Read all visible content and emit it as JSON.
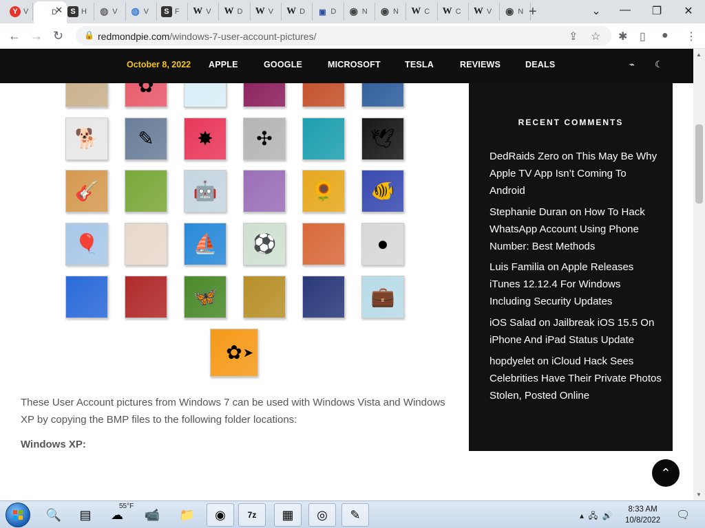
{
  "browser": {
    "tabs": [
      {
        "letter": "V",
        "icon": "yandex-icon",
        "color": "#e5322d",
        "glyph": "Y"
      },
      {
        "letter": "D",
        "icon": "page-icon",
        "color": "#ffffff",
        "glyph": ""
      },
      {
        "letter": "H",
        "icon": "s-icon",
        "color": "#333333",
        "glyph": "S"
      },
      {
        "letter": "V",
        "icon": "globe-icon",
        "color": "#666666",
        "glyph": "◍"
      },
      {
        "letter": "V",
        "icon": "globe-color-icon",
        "color": "#3b7dd8",
        "glyph": "◍"
      },
      {
        "letter": "F",
        "icon": "s-icon",
        "color": "#333333",
        "glyph": "S"
      },
      {
        "letter": "V",
        "icon": "wikipedia-icon",
        "color": "#222222",
        "glyph": "W"
      },
      {
        "letter": "D",
        "icon": "wikipedia-icon",
        "color": "#222222",
        "glyph": "W"
      },
      {
        "letter": "V",
        "icon": "wikipedia-icon",
        "color": "#222222",
        "glyph": "W"
      },
      {
        "letter": "D",
        "icon": "wikipedia-icon",
        "color": "#222222",
        "glyph": "W"
      },
      {
        "letter": "D",
        "icon": "monitor-icon",
        "color": "#2a4fa0",
        "glyph": "▣"
      },
      {
        "letter": "N",
        "icon": "github-icon",
        "color": "#444444",
        "glyph": "◉"
      },
      {
        "letter": "N",
        "icon": "github-icon",
        "color": "#444444",
        "glyph": "◉"
      },
      {
        "letter": "C",
        "icon": "wikipedia-icon",
        "color": "#222222",
        "glyph": "W"
      },
      {
        "letter": "C",
        "icon": "wikipedia-icon",
        "color": "#222222",
        "glyph": "W"
      },
      {
        "letter": "V",
        "icon": "wikipedia-icon",
        "color": "#222222",
        "glyph": "W"
      },
      {
        "letter": "N",
        "icon": "github-icon",
        "color": "#444444",
        "glyph": "◉"
      }
    ],
    "url_domain": "redmondpie.com",
    "url_path": "/windows-7-user-account-pictures/"
  },
  "site_nav": {
    "date": "October 8, 2022",
    "links": [
      "APPLE",
      "GOOGLE",
      "MICROSOFT",
      "TESLA",
      "REVIEWS",
      "DEALS"
    ]
  },
  "gallery": [
    {
      "name": "cat-picture",
      "bg": "#c9b08a",
      "glyph": ""
    },
    {
      "name": "flower-pink-picture",
      "bg": "#e85a6a",
      "glyph": "✿"
    },
    {
      "name": "pinwheel-picture",
      "bg": "#d9eef7",
      "glyph": ""
    },
    {
      "name": "egg-picture",
      "bg": "#8b1f5b",
      "glyph": ""
    },
    {
      "name": "fabric-picture",
      "bg": "#c4502a",
      "glyph": ""
    },
    {
      "name": "leaf-picture",
      "bg": "#2f5d9c",
      "glyph": ""
    },
    {
      "name": "dog-picture",
      "bg": "#e8e8e8",
      "glyph": "🐕"
    },
    {
      "name": "crayons-picture",
      "bg": "#6a7f9a",
      "glyph": "✎"
    },
    {
      "name": "star-picture",
      "bg": "#e8395a",
      "glyph": "✸"
    },
    {
      "name": "jacks-picture",
      "bg": "#b5b5b5",
      "glyph": "✣"
    },
    {
      "name": "stairs-picture",
      "bg": "#1f9fb0",
      "glyph": ""
    },
    {
      "name": "crane-picture",
      "bg": "#181818",
      "glyph": "🕊"
    },
    {
      "name": "guitar-picture",
      "bg": "#d59a52",
      "glyph": "🎸"
    },
    {
      "name": "pomeranian-picture",
      "bg": "#7aa83a",
      "glyph": ""
    },
    {
      "name": "robot-picture",
      "bg": "#c6d6e0",
      "glyph": "🤖"
    },
    {
      "name": "scarf-picture",
      "bg": "#9a6fb8",
      "glyph": ""
    },
    {
      "name": "sunflower-picture",
      "bg": "#e6a81e",
      "glyph": "🌻"
    },
    {
      "name": "fish-picture",
      "bg": "#3a4bb0",
      "glyph": "🐠"
    },
    {
      "name": "balloon-picture",
      "bg": "#a8c8e8",
      "glyph": "🎈"
    },
    {
      "name": "doll-picture",
      "bg": "#e8d8cc",
      "glyph": ""
    },
    {
      "name": "sailboat-picture",
      "bg": "#2a8ad8",
      "glyph": "⛵"
    },
    {
      "name": "soccer-ball-picture",
      "bg": "#cfe0d0",
      "glyph": "⚽"
    },
    {
      "name": "fabric-orange-picture",
      "bg": "#d86a3a",
      "glyph": ""
    },
    {
      "name": "marbles-picture",
      "bg": "#d8d8d8",
      "glyph": "●"
    },
    {
      "name": "window-picture",
      "bg": "#2a6ad8",
      "glyph": ""
    },
    {
      "name": "tribal-pattern-picture",
      "bg": "#b02a2a",
      "glyph": ""
    },
    {
      "name": "butterfly-picture",
      "bg": "#4a8a2a",
      "glyph": "🦋"
    },
    {
      "name": "spiral-picture",
      "bg": "#b8902a",
      "glyph": ""
    },
    {
      "name": "lighthouse-picture",
      "bg": "#2a3a7a",
      "glyph": ""
    },
    {
      "name": "suitcase-picture",
      "bg": "#b8dbe8",
      "glyph": "💼"
    },
    {
      "name": "daisy-orange-picture",
      "bg": "#f59a1a",
      "glyph": "✿"
    }
  ],
  "article": {
    "paragraph": "These User Account pictures from Windows 7 can be used with Windows Vista and Windows XP by copying the BMP files to the following folder locations:",
    "heading": "Windows XP:"
  },
  "sidebar": {
    "title": "RECENT COMMENTS",
    "comments": [
      {
        "text": "DedRaids Zero on This May Be Why Apple TV App Isn’t Coming To Android"
      },
      {
        "text": "Stephanie Duran on How To Hack WhatsApp Account Using Phone Number: Best Methods"
      },
      {
        "text": "Luis Familia on Apple Releases iTunes 12.12.4 For Windows Including Security Updates"
      },
      {
        "text": "iOS Salad on Jailbreak iOS 15.5 On iPhone And iPad Status Update"
      },
      {
        "text": "hopdyelet on iCloud Hack Sees Celebrities Have Their Private Photos Stolen, Posted Online"
      }
    ]
  },
  "taskbar": {
    "weather_temp": "55°F",
    "clock_time": "8:33 AM",
    "clock_date": "10/8/2022",
    "apps": [
      {
        "name": "search-taskbar-icon",
        "glyph": "🔍"
      },
      {
        "name": "taskview-taskbar-icon",
        "glyph": "▤"
      },
      {
        "name": "weather-taskbar-icon",
        "glyph": "☁"
      },
      {
        "name": "meet-taskbar-icon",
        "glyph": "📹"
      },
      {
        "name": "file-explorer-taskbar-icon",
        "glyph": "📁"
      },
      {
        "name": "chrome-taskbar-icon",
        "glyph": "◉"
      },
      {
        "name": "7zip-taskbar-icon",
        "glyph": "7z"
      },
      {
        "name": "task-manager-taskbar-icon",
        "glyph": "▦"
      },
      {
        "name": "browser-taskbar-icon",
        "glyph": "◎"
      },
      {
        "name": "app-taskbar-icon",
        "glyph": "✎"
      }
    ]
  }
}
